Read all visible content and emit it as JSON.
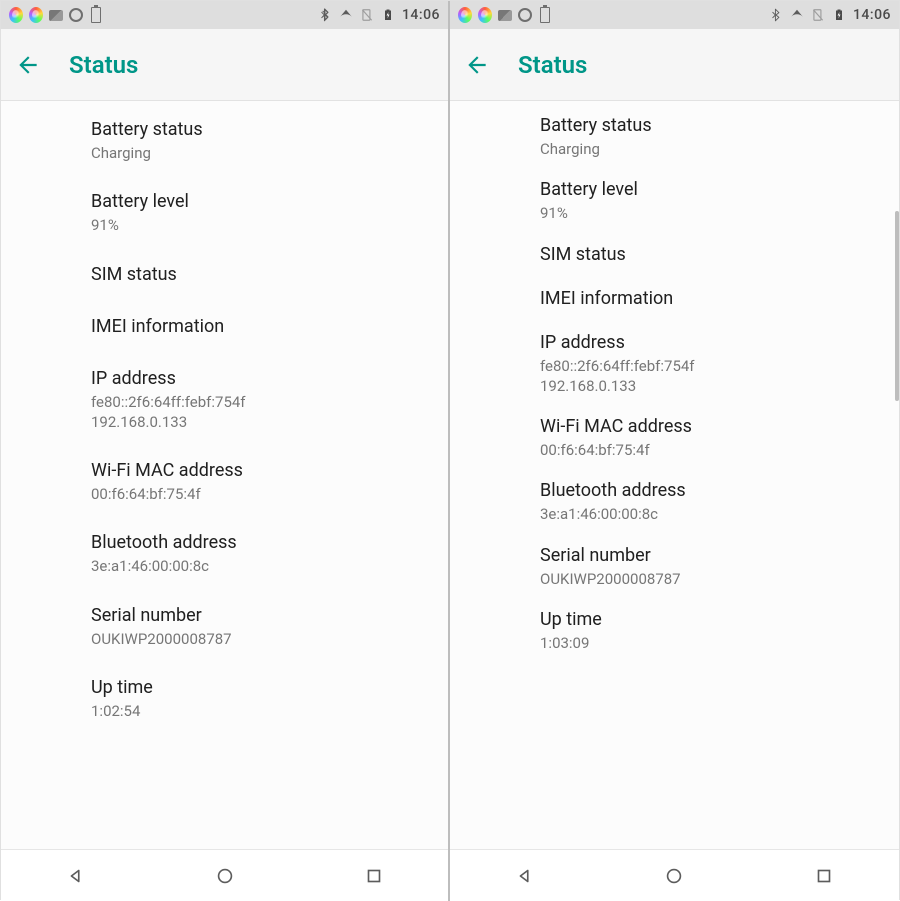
{
  "statusbar": {
    "time": "14:06"
  },
  "header": {
    "title": "Status"
  },
  "left": {
    "items": [
      {
        "title": "Battery status",
        "value": "Charging"
      },
      {
        "title": "Battery level",
        "value": "91%"
      },
      {
        "title": "SIM status",
        "value": ""
      },
      {
        "title": "IMEI information",
        "value": ""
      },
      {
        "title": "IP address",
        "value": "fe80::2f6:64ff:febf:754f\n192.168.0.133"
      },
      {
        "title": "Wi-Fi MAC address",
        "value": "00:f6:64:bf:75:4f"
      },
      {
        "title": "Bluetooth address",
        "value": "3e:a1:46:00:00:8c"
      },
      {
        "title": "Serial number",
        "value": "OUKIWP2000008787"
      },
      {
        "title": "Up time",
        "value": "1:02:54"
      }
    ]
  },
  "right": {
    "items": [
      {
        "title": "Battery status",
        "value": "Charging"
      },
      {
        "title": "Battery level",
        "value": "91%"
      },
      {
        "title": "SIM status",
        "value": ""
      },
      {
        "title": "IMEI information",
        "value": ""
      },
      {
        "title": "IP address",
        "value": "fe80::2f6:64ff:febf:754f\n192.168.0.133"
      },
      {
        "title": "Wi-Fi MAC address",
        "value": "00:f6:64:bf:75:4f"
      },
      {
        "title": "Bluetooth address",
        "value": "3e:a1:46:00:00:8c"
      },
      {
        "title": "Serial number",
        "value": "OUKIWP2000008787"
      },
      {
        "title": "Up time",
        "value": "1:03:09"
      }
    ]
  }
}
